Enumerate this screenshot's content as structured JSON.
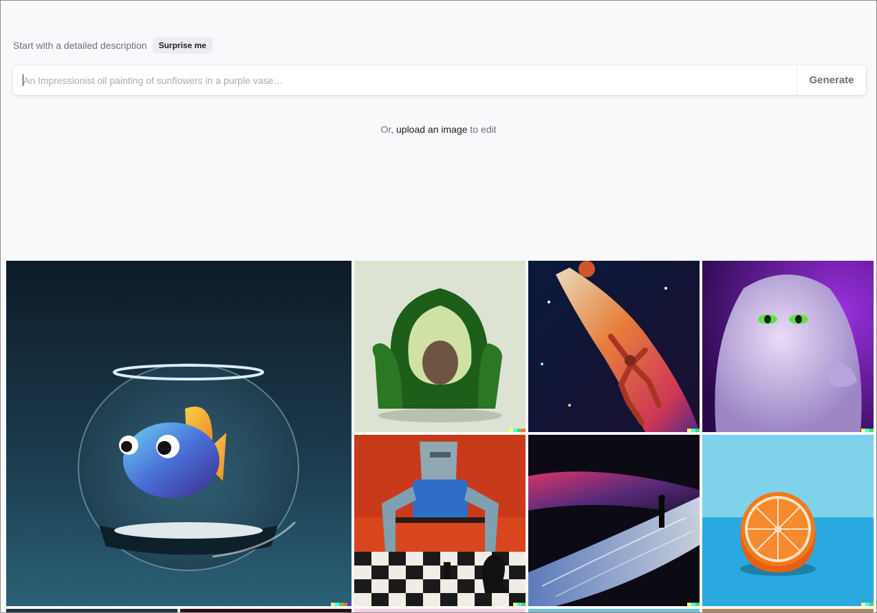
{
  "prompt": {
    "label": "Start with a detailed description",
    "surprise_label": "Surprise me"
  },
  "search": {
    "value": "",
    "placeholder": "An Impressionist oil painting of sunflowers in a purple vase…",
    "generate_label": "Generate"
  },
  "upload": {
    "prefix": "Or, ",
    "link_label": "upload an image",
    "suffix": " to edit"
  },
  "gallery": {
    "tiles": [
      {
        "subject": "fish-in-bowl"
      },
      {
        "subject": "avocado-chair"
      },
      {
        "subject": "cosmic-basketball"
      },
      {
        "subject": "purple-monster"
      },
      {
        "subject": "robot-chess"
      },
      {
        "subject": "dunes-figure"
      },
      {
        "subject": "orange-half"
      }
    ],
    "watermark_colors": [
      "#ffff66",
      "#42ffff",
      "#51da4c",
      "#ff6e3c",
      "#3c46ff"
    ]
  },
  "colors": {
    "background": "#f9f9fb",
    "text_muted": "#6e6e80",
    "text_dark": "#202123"
  }
}
